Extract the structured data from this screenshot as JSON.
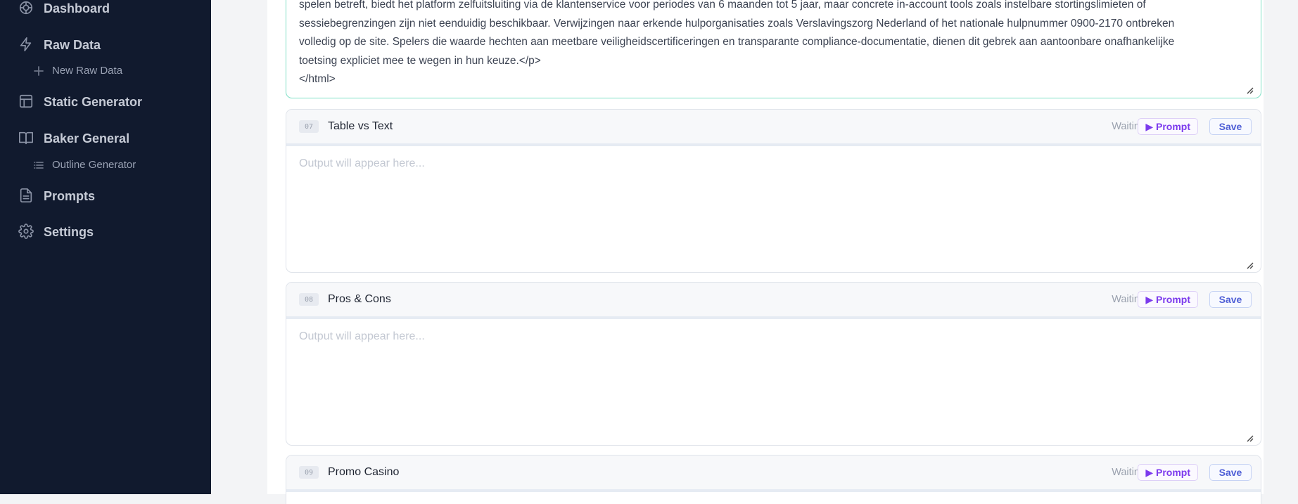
{
  "sidebar": {
    "items": [
      {
        "label": "Dashboard",
        "icon": "dashboard-icon"
      },
      {
        "label": "Raw Data",
        "icon": "lightning-icon"
      },
      {
        "label": "New Raw Data",
        "icon": "plus-icon"
      },
      {
        "label": "Static Generator",
        "icon": "layout-icon"
      },
      {
        "label": "Baker General",
        "icon": "book-icon"
      },
      {
        "label": "Outline Generator",
        "icon": "list-icon"
      },
      {
        "label": "Prompts",
        "icon": "document-icon"
      },
      {
        "label": "Settings",
        "icon": "gear-icon"
      }
    ]
  },
  "editor": {
    "content": "spelen betreft, biedt het platform zelfuitsluiting via de klantenservice voor periodes van 6 maanden tot 5 jaar, maar concrete in-account tools zoals instelbare stortingslimieten of\nsessiebegrenzingen zijn niet eenduidig beschikbaar. Verwijzingen naar erkende hulporganisaties zoals Verslavingszorg Nederland of het nationale hulpnummer 0900-2170 ontbreken\nvolledig op de site. Spelers die waarde hechten aan meetbare veiligheidscertificeringen en transparante compliance-documentatie, dienen dit gebrek aan aantoonbare onafhankelijke\ntoetsing expliciet mee te wegen in hun keuze.</p>\n</html>"
  },
  "cards": [
    {
      "num": "07",
      "title": "Table vs Text",
      "status": "Waiting",
      "prompt_label": "▶ Prompt",
      "save_label": "Save",
      "placeholder": "Output will appear here..."
    },
    {
      "num": "08",
      "title": "Pros & Cons",
      "status": "Waiting",
      "prompt_label": "▶ Prompt",
      "save_label": "Save",
      "placeholder": "Output will appear here..."
    },
    {
      "num": "09",
      "title": "Promo Casino",
      "status": "Waiting",
      "prompt_label": "▶ Prompt",
      "save_label": "Save"
    }
  ],
  "colors": {
    "sidebar_bg": "#111a2e",
    "accent_prompt": "#7c3aed",
    "accent_save": "#4f5fd6",
    "editor_border": "#7ee0c6"
  }
}
